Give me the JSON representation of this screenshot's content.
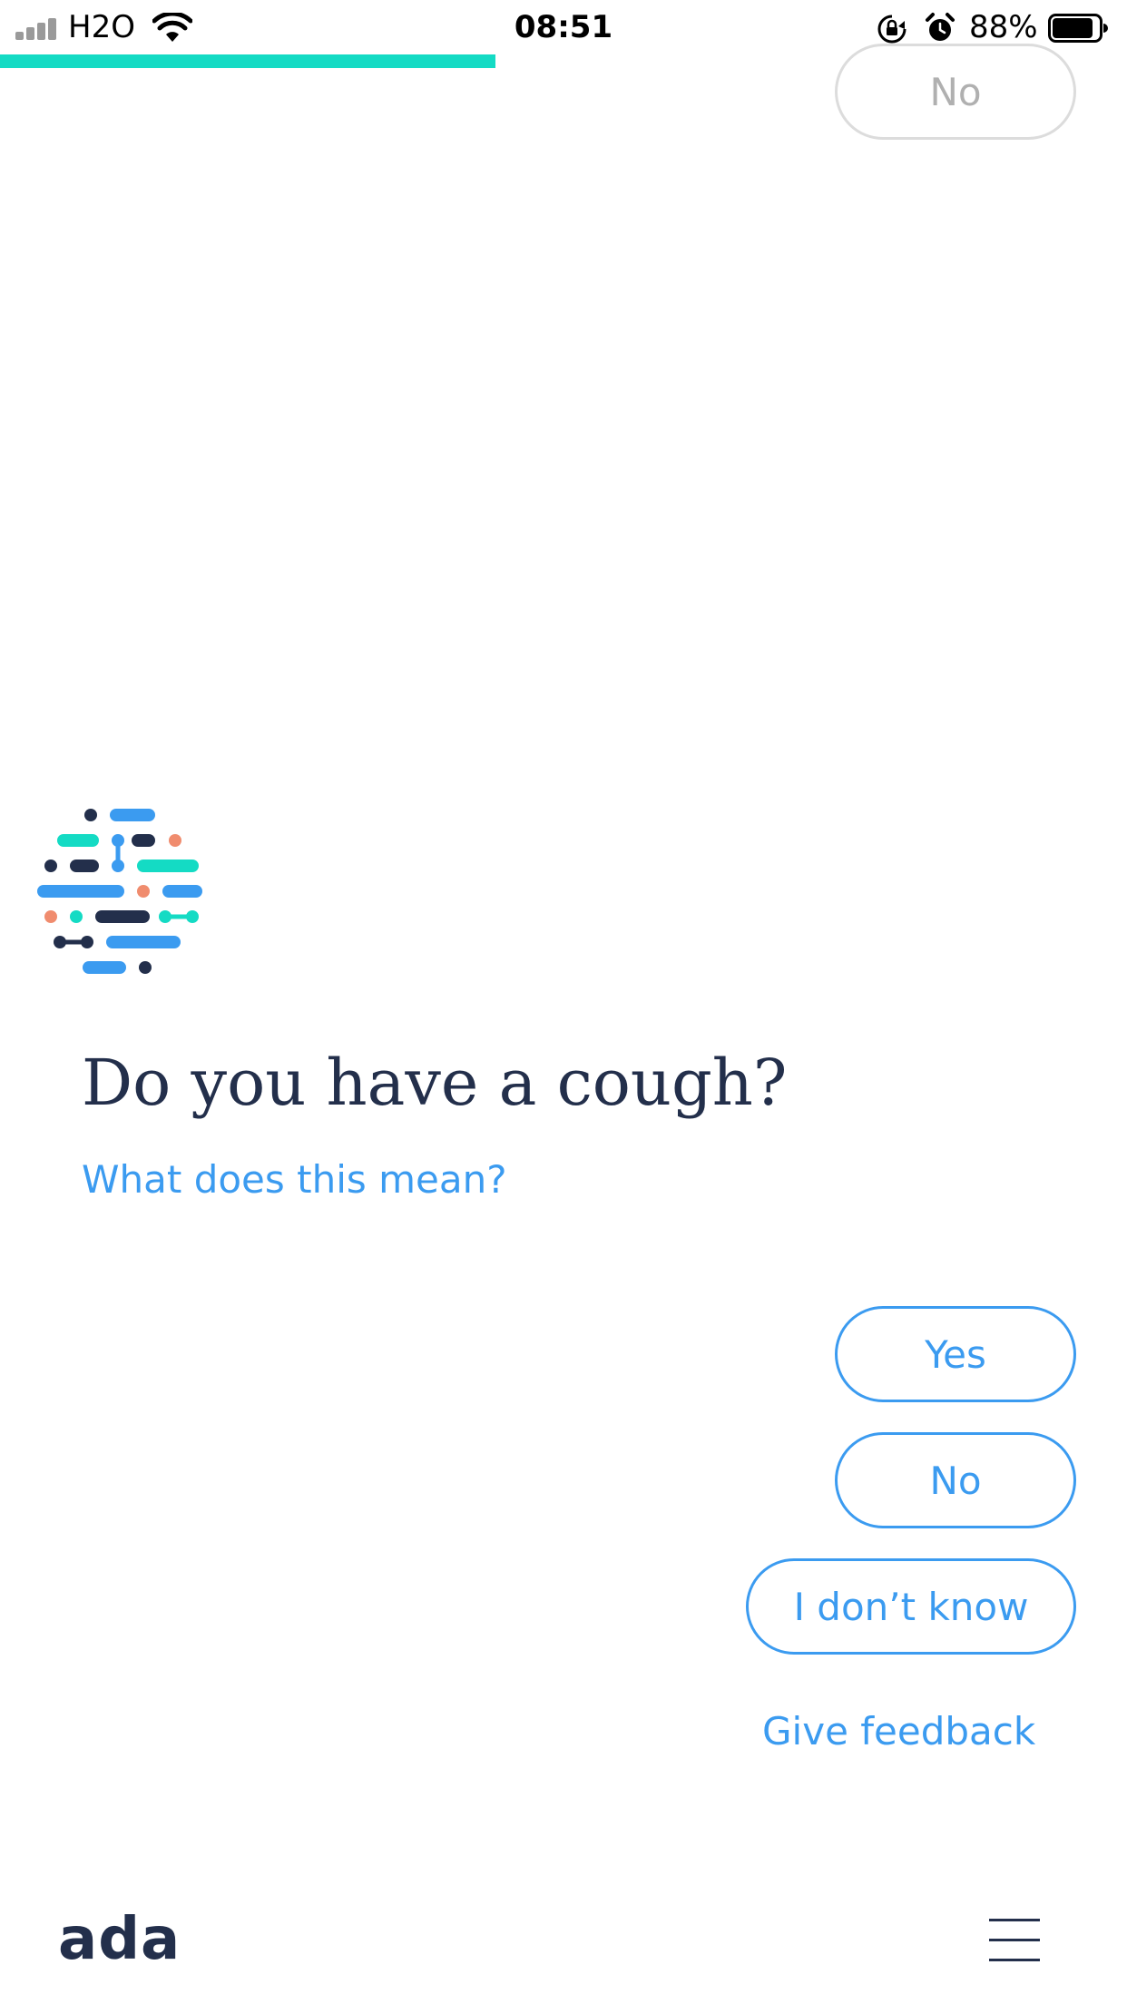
{
  "status_bar": {
    "carrier": "H2O",
    "time": "08:51",
    "battery": "88%",
    "battery_level": 0.88,
    "signal_bars_active": 4,
    "icons": [
      "signal-icon",
      "wifi-icon",
      "rotation-lock-icon",
      "alarm-icon",
      "battery-icon"
    ]
  },
  "progress": {
    "fraction": 0.44,
    "color": "#14dbc4"
  },
  "previous_answer": {
    "label": "No"
  },
  "chat": {
    "avatar_icon": "ada-logo-icon",
    "question": "Do you have a cough?",
    "help_link": "What does this mean?"
  },
  "answers": {
    "yes": "Yes",
    "no": "No",
    "dont_know": "I don’t know"
  },
  "feedback_link": "Give feedback",
  "footer": {
    "brand": "ada",
    "menu_icon": "hamburger-menu-icon"
  },
  "colors": {
    "primary_text": "#232f4b",
    "accent_blue": "#3b9bf0",
    "teal": "#14dbc4",
    "coral": "#f08c6e",
    "muted_border": "#dcdcdc"
  }
}
